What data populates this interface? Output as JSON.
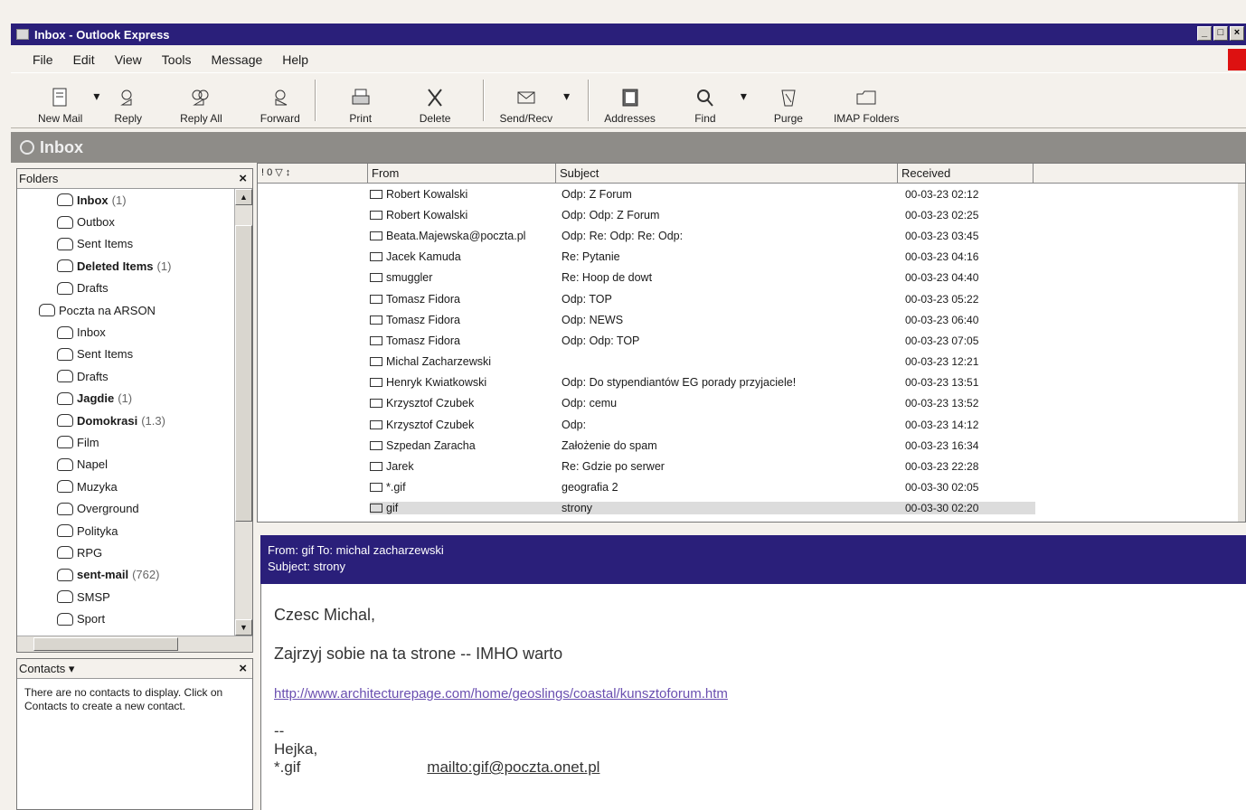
{
  "window": {
    "title": "Inbox - Outlook Express",
    "buttons": [
      "_",
      "□",
      "×"
    ]
  },
  "menu": [
    "File",
    "Edit",
    "View",
    "Tools",
    "Message",
    "Help"
  ],
  "toolbar": {
    "new_mail": "New Mail",
    "reply": "Reply",
    "reply_all": "Reply All",
    "forward": "Forward",
    "print": "Print",
    "delete": "Delete",
    "send_recv": "Send/Recv",
    "addresses": "Addresses",
    "find": "Find",
    "purge": "Purge",
    "imap_folders": "IMAP Folders",
    "dropdown": "▾"
  },
  "folder_header": "Inbox",
  "folders_pane": {
    "title": "Folders",
    "close": "×",
    "items": [
      {
        "label": "Inbox",
        "count": "(1)",
        "bold": true,
        "indent": 1
      },
      {
        "label": "Outbox",
        "count": "",
        "bold": false,
        "indent": 1
      },
      {
        "label": "Sent Items",
        "count": "",
        "bold": false,
        "indent": 1
      },
      {
        "label": "Deleted Items",
        "count": "(1)",
        "bold": true,
        "indent": 1
      },
      {
        "label": "Drafts",
        "count": "",
        "bold": false,
        "indent": 1
      },
      {
        "label": "Poczta na ARSON",
        "count": "",
        "bold": false,
        "indent": 0
      },
      {
        "label": "Inbox",
        "count": "",
        "bold": false,
        "indent": 1
      },
      {
        "label": "Sent Items",
        "count": "",
        "bold": false,
        "indent": 1
      },
      {
        "label": "Drafts",
        "count": "",
        "bold": false,
        "indent": 1
      },
      {
        "label": "Jagdie",
        "count": "(1)",
        "bold": true,
        "indent": 1
      },
      {
        "label": "Domokrasi",
        "count": "(1.3)",
        "bold": true,
        "indent": 1
      },
      {
        "label": "Film",
        "count": "",
        "bold": false,
        "indent": 1
      },
      {
        "label": "Napel",
        "count": "",
        "bold": false,
        "indent": 1
      },
      {
        "label": "Muzyka",
        "count": "",
        "bold": false,
        "indent": 1
      },
      {
        "label": "Overground",
        "count": "",
        "bold": false,
        "indent": 1
      },
      {
        "label": "Polityka",
        "count": "",
        "bold": false,
        "indent": 1
      },
      {
        "label": "RPG",
        "count": "",
        "bold": false,
        "indent": 1
      },
      {
        "label": "sent-mail",
        "count": "(762)",
        "bold": true,
        "indent": 1
      },
      {
        "label": "SMSP",
        "count": "",
        "bold": false,
        "indent": 1
      },
      {
        "label": "Sport",
        "count": "",
        "bold": false,
        "indent": 1
      }
    ]
  },
  "contacts_pane": {
    "title": "Contacts ▾",
    "close": "×",
    "note": "There are no contacts to display. Click on Contacts to create a new contact."
  },
  "message_list": {
    "columns": {
      "icons": "! 0 ▽ ↕",
      "from": "From",
      "subject": "Subject",
      "received": "Received"
    },
    "rows": [
      {
        "from": "Robert Kowalski",
        "subject": "Odp: Z Forum",
        "received": "00-03-23 02:12"
      },
      {
        "from": "Robert Kowalski",
        "subject": "Odp: Odp: Z Forum",
        "received": "00-03-23 02:25"
      },
      {
        "from": "Beata.Majewska@poczta.pl",
        "subject": "Odp: Re: Odp: Re: Odp:",
        "received": "00-03-23 03:45"
      },
      {
        "from": "Jacek Kamuda",
        "subject": "Re: Pytanie",
        "received": "00-03-23 04:16"
      },
      {
        "from": "smuggler",
        "subject": "Re: Hoop de dowt",
        "received": "00-03-23 04:40"
      },
      {
        "from": "Tomasz Fidora",
        "subject": "Odp: TOP",
        "received": "00-03-23 05:22"
      },
      {
        "from": "Tomasz Fidora",
        "subject": "Odp: NEWS",
        "received": "00-03-23 06:40"
      },
      {
        "from": "Tomasz Fidora",
        "subject": "Odp: Odp: TOP",
        "received": "00-03-23 07:05"
      },
      {
        "from": "Michal Zacharzewski",
        "subject": "",
        "received": "00-03-23 12:21"
      },
      {
        "from": "Henryk Kwiatkowski",
        "subject": "Odp: Do stypendiantów EG porady przyjaciele!",
        "received": "00-03-23 13:51"
      },
      {
        "from": "Krzysztof Czubek",
        "subject": "Odp: cemu",
        "received": "00-03-23 13:52"
      },
      {
        "from": "Krzysztof Czubek",
        "subject": "Odp:",
        "received": "00-03-23 14:12"
      },
      {
        "from": "Szpedan Zaracha",
        "subject": "Założenie do spam",
        "received": "00-03-23 16:34"
      },
      {
        "from": "Jarek",
        "subject": "Re: Gdzie po serwer",
        "received": "00-03-23 22:28"
      },
      {
        "from": "*.gif",
        "subject": "geografia 2",
        "received": "00-03-30 02:05"
      },
      {
        "from": "gif",
        "subject": "strony",
        "received": "00-03-30 02:20",
        "selected": true
      }
    ]
  },
  "preview": {
    "from_line": "From: gif  To: michal zacharzewski",
    "subject_line": "Subject: strony",
    "greeting": "Czesc Michal,",
    "body": "Zajrzyj sobie na ta strone -- IMHO warto",
    "link": "http://www.architecturepage.com/home/geoslings/coastal/kunsztoforum.htm",
    "sig_dash": "--",
    "sig_name": "Hejka,",
    "sig_from": "*.gif",
    "mailto": "mailto:gif@poczta.onet.pl"
  }
}
